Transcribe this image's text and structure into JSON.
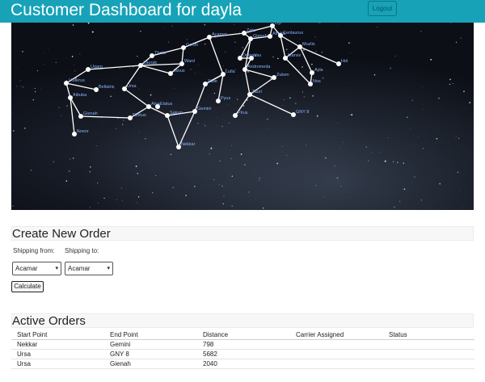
{
  "header": {
    "title": "Customer Dashboard for dayla",
    "logout_label": "Logout"
  },
  "map": {
    "zoom_in_label": "+",
    "zoom_out_label": "-",
    "nodes": [
      {
        "id": "Dyl",
        "label": "Dyl"
      },
      {
        "id": "Zeta",
        "label": "Zeta"
      },
      {
        "id": "Acamar",
        "label": "Acamar"
      },
      {
        "id": "Gienah",
        "label": "Gienah"
      },
      {
        "id": "Gersh",
        "label": "Gersh"
      },
      {
        "id": "Alrakis",
        "label": "Alrakis"
      },
      {
        "id": "Cenlaurus",
        "label": "Cenlaurus"
      },
      {
        "id": "Theta",
        "label": "Theta"
      },
      {
        "id": "Zaurak",
        "label": "Zaurak"
      },
      {
        "id": "Ward",
        "label": "Ward"
      },
      {
        "id": "Janus",
        "label": "Janus"
      },
      {
        "id": "Ugaro",
        "label": "Ugaro"
      },
      {
        "id": "Volterus",
        "label": "Volterus"
      },
      {
        "id": "Bellatrix",
        "label": "Bellatrix"
      },
      {
        "id": "Xibuba",
        "label": "Xibuba"
      },
      {
        "id": "Ursa",
        "label": "Ursa"
      },
      {
        "id": "Gienah2",
        "label": "Gienah"
      },
      {
        "id": "Koeor",
        "label": "Koeor"
      },
      {
        "id": "Rinkus",
        "label": "Rinkus"
      },
      {
        "id": "Alya",
        "label": "Alya"
      },
      {
        "id": "Elatus",
        "label": "Elatus"
      },
      {
        "id": "Saturn",
        "label": "Saturn"
      },
      {
        "id": "Nekkar",
        "label": "Nekkar"
      },
      {
        "id": "Gemini",
        "label": "Gemini"
      },
      {
        "id": "Lulla",
        "label": "Lulla"
      },
      {
        "id": "Stille",
        "label": "Stille"
      },
      {
        "id": "Pyus",
        "label": "Pyus"
      },
      {
        "id": "Dolgas",
        "label": "Dolgas"
      },
      {
        "id": "Vas",
        "label": "Vas"
      },
      {
        "id": "Andromeda",
        "label": "Andromeda"
      },
      {
        "id": "Zuben",
        "label": "Zuben"
      },
      {
        "id": "Tauri",
        "label": "Tauri"
      },
      {
        "id": "Pirus",
        "label": "Pirus"
      },
      {
        "id": "Marvix",
        "label": "Marvix"
      },
      {
        "id": "Muzlis",
        "label": "Muzlis"
      },
      {
        "id": "Ayla",
        "label": "Ayla"
      },
      {
        "id": "Nos",
        "label": "Nos"
      },
      {
        "id": "Hol",
        "label": "Hol"
      },
      {
        "id": "GNY8",
        "label": "GNY 8"
      }
    ]
  },
  "create_order": {
    "title": "Create New Order",
    "shipping_from_label": "Shipping from:",
    "shipping_to_label": "Shipping to:",
    "shipping_from_value": "Acamar",
    "shipping_to_value": "Acamar",
    "calculate_label": "Calculate"
  },
  "active_orders": {
    "title": "Active Orders",
    "columns": [
      "Start Point",
      "End Point",
      "Distance",
      "Carrier Assigned",
      "Status"
    ],
    "rows": [
      [
        "Nekkar",
        "Gemini",
        "798",
        "",
        ""
      ],
      [
        "Ursa",
        "GNY 8",
        "5682",
        "",
        ""
      ],
      [
        "Ursa",
        "Gienah",
        "2040",
        "",
        ""
      ]
    ]
  },
  "colors": {
    "header": "#17a2b8",
    "node_label": "#8ab4ff",
    "edge": "#ffffff"
  }
}
